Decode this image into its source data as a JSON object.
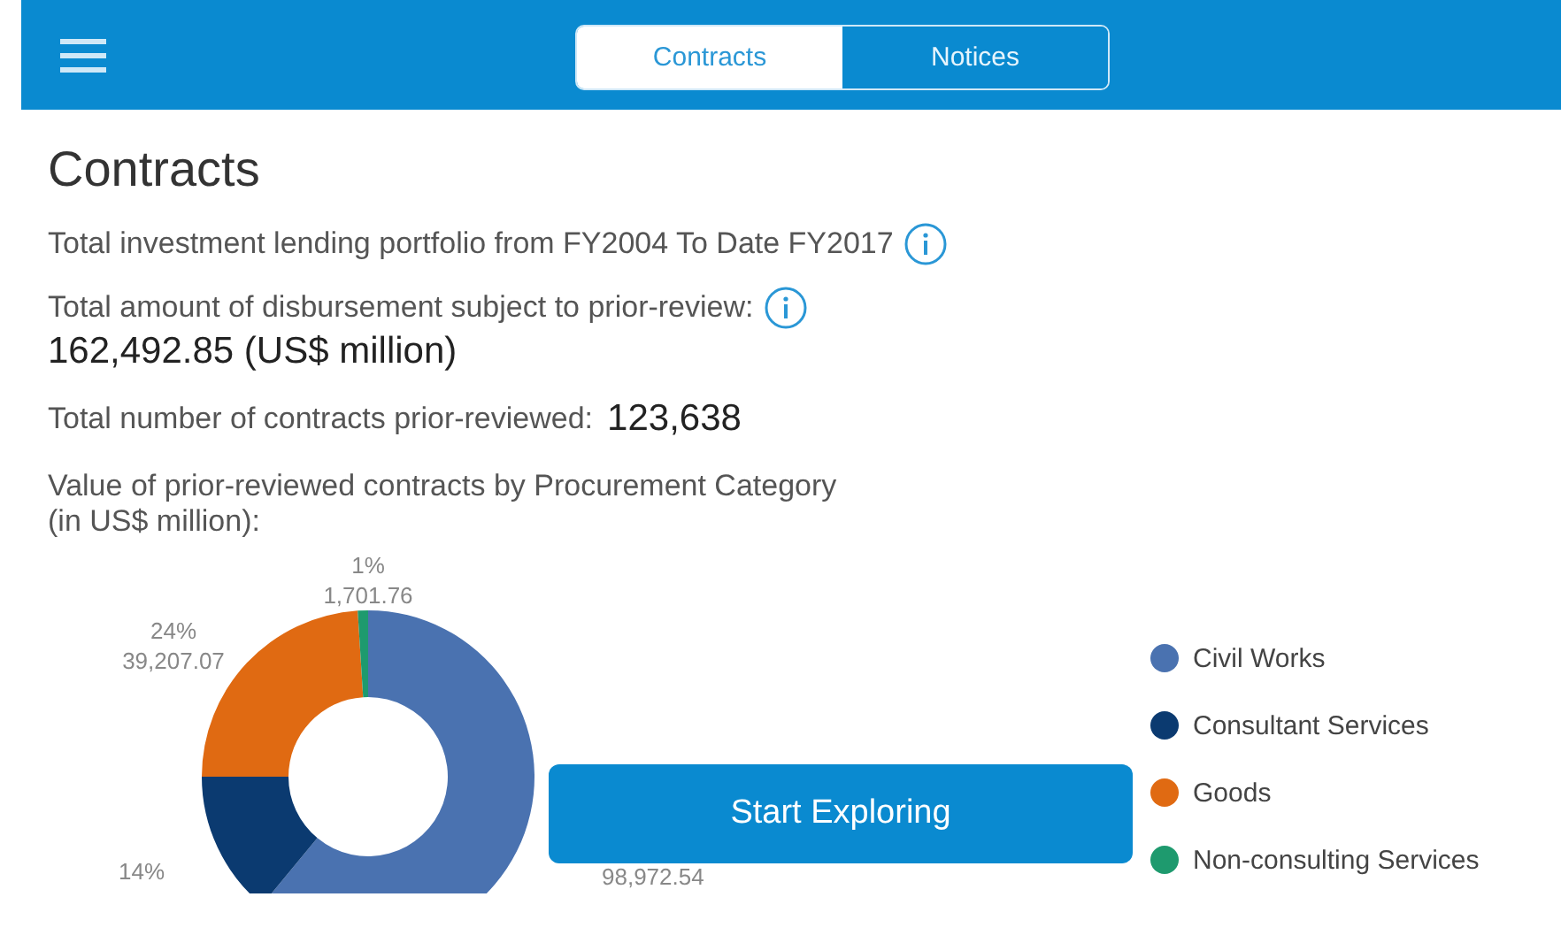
{
  "tabs": [
    {
      "label": "Contracts",
      "selected": true
    },
    {
      "label": "Notices",
      "selected": false
    }
  ],
  "title": "Contracts",
  "portfolio_text": "Total investment lending portfolio from FY2004 To Date FY2017",
  "disbursement_label": "Total amount of disbursement subject to prior-review:",
  "disbursement_value": "162,492.85 (US$ million)",
  "contracts_label": "Total number of contracts prior-reviewed:",
  "contracts_value": "123,638",
  "chart_caption": "Value of prior-reviewed contracts by Procurement Category\n(in US$ million):",
  "chart": {
    "chart_data": {
      "type": "donut",
      "categories": [
        "Civil Works",
        "Consultant Services",
        "Goods",
        "Non-consulting Services"
      ],
      "series": [
        {
          "values": [
            61,
            14,
            24,
            1
          ]
        }
      ]
    },
    "slice_labels": [
      {
        "lines": [
          "98,972.54"
        ]
      },
      {
        "lines": [
          "14%"
        ]
      },
      {
        "lines": [
          "24%",
          "39,207.07"
        ]
      },
      {
        "lines": [
          "1%",
          "1,701.76"
        ]
      }
    ],
    "slice_colors": [
      {
        "color": "#4a72b0"
      },
      {
        "color": "#0b3a70"
      },
      {
        "color": "#e06a12"
      },
      {
        "color": "#1e9a6e"
      }
    ]
  },
  "start_button": "Start Exploring"
}
